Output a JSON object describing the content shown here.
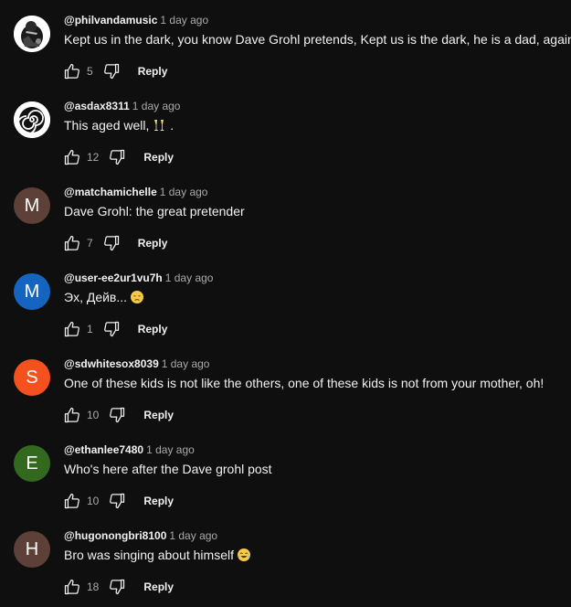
{
  "comments": [
    {
      "author": "@philvandamusic",
      "time": "1 day ago",
      "text": "Kept us in the dark, you know Dave Grohl pretends, Kept us is the dark, he is a dad, again",
      "likes": "5",
      "reply_label": "Reply",
      "avatar": {
        "type": "image",
        "icon": "bw-photo-avatar",
        "color": "#ffffff"
      }
    },
    {
      "author": "@asdax8311",
      "time": "1 day ago",
      "text": "This aged well,",
      "emoji": "champagne-glasses",
      "text_suffix": ".",
      "likes": "12",
      "reply_label": "Reply",
      "avatar": {
        "type": "image",
        "icon": "spiral-avatar",
        "color": "#ffffff"
      }
    },
    {
      "author": "@matchamichelle",
      "time": "1 day ago",
      "text": "Dave Grohl: the great pretender",
      "likes": "7",
      "reply_label": "Reply",
      "avatar": {
        "type": "letter",
        "letter": "M",
        "color": "#5d4037"
      }
    },
    {
      "author": "@user-ee2ur1vu7h",
      "time": "1 day ago",
      "text": "Эх, Дейв...",
      "emoji": "disappointed-face",
      "likes": "1",
      "reply_label": "Reply",
      "avatar": {
        "type": "letter",
        "letter": "M",
        "color": "#1565c0"
      }
    },
    {
      "author": "@sdwhitesox8039",
      "time": "1 day ago",
      "text": "One of these kids is not like the others, one of these kids is not from your mother, oh!",
      "likes": "10",
      "reply_label": "Reply",
      "avatar": {
        "type": "letter",
        "letter": "S",
        "color": "#f4511e"
      }
    },
    {
      "author": "@ethanlee7480",
      "time": "1 day ago",
      "text": "Who's here after the Dave grohl post",
      "likes": "10",
      "reply_label": "Reply",
      "avatar": {
        "type": "letter",
        "letter": "E",
        "color": "#33691e"
      }
    },
    {
      "author": "@hugonongbri8100",
      "time": "1 day ago",
      "text": "Bro was singing about himself",
      "emoji": "tears-of-joy-face",
      "likes": "18",
      "reply_label": "Reply",
      "avatar": {
        "type": "letter",
        "letter": "H",
        "color": "#5d4037"
      }
    }
  ],
  "icons": {
    "like": "thumbs-up-icon",
    "dislike": "thumbs-down-icon"
  },
  "colors": {
    "background": "#0f0f0f",
    "primary_text": "#f1f1f1",
    "secondary_text": "#aaaaaa"
  }
}
